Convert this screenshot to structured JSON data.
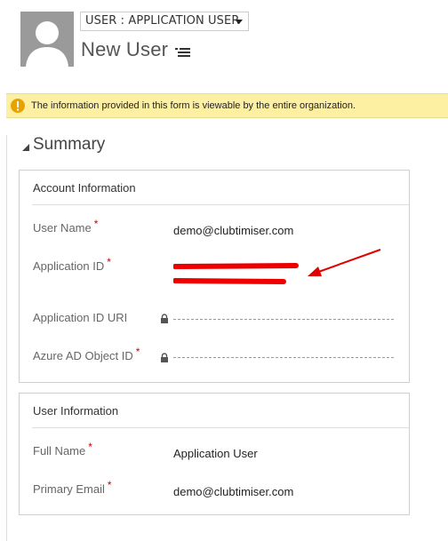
{
  "header": {
    "form_selector": "USER : APPLICATION USER",
    "record_title": "New User"
  },
  "banner": {
    "message": "The information provided in this form is viewable by the entire organization."
  },
  "summary": {
    "title": "Summary",
    "account_info": {
      "title": "Account Information",
      "fields": {
        "user_name": {
          "label": "User Name",
          "value": "demo@clubtimiser.com",
          "required": "*"
        },
        "application_id": {
          "label": "Application ID",
          "required": "*"
        },
        "application_id_uri": {
          "label": "Application ID URI"
        },
        "azure_ad_object_id": {
          "label": "Azure AD Object ID",
          "required": "*"
        }
      }
    },
    "user_info": {
      "title": "User Information",
      "fields": {
        "full_name": {
          "label": "Full Name",
          "value": "Application User",
          "required": "*"
        },
        "primary_email": {
          "label": "Primary Email",
          "value": "demo@clubtimiser.com",
          "required": "*"
        }
      }
    }
  },
  "colors": {
    "warning_bg": "#fdf0a2",
    "warning_icon": "#e8a200",
    "required": "#cc0000",
    "redaction": "#ee0000"
  }
}
